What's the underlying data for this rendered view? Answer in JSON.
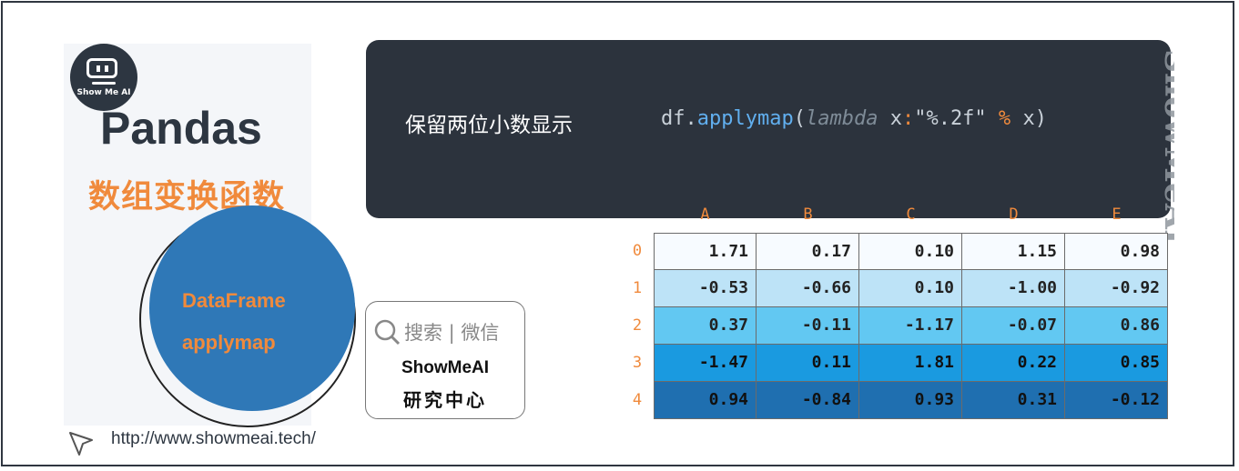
{
  "brand": {
    "logo_text": "Show Me AI",
    "title": "Pandas",
    "subtitle": "数组变换函数",
    "circle_line1": "DataFrame",
    "circle_line2": "applymap",
    "url": "http://www.showmeai.tech/",
    "badge_search": "搜索 | 微信",
    "badge_name": "ShowMeAI",
    "badge_sub": "研究中心",
    "watermark": "ShowMeAI"
  },
  "code": {
    "label": "保留两位小数显示",
    "tokens": {
      "obj": "df",
      "dot": ".",
      "fn": "applymap",
      "paren_open": "(",
      "kw": "lambda",
      "space": " ",
      "arg": "x",
      "colon": ":",
      "fmt": "\"%.2f\"",
      "op": " % ",
      "arg2": "x",
      "paren_close": ")"
    }
  },
  "table": {
    "columns": [
      "A",
      "B",
      "C",
      "D",
      "E"
    ],
    "index": [
      "0",
      "1",
      "2",
      "3",
      "4"
    ],
    "row_colors": [
      "#f7fbff",
      "#bde3f7",
      "#62c8f2",
      "#1a9ae0",
      "#1f6fb0"
    ],
    "rows": [
      [
        "1.71",
        "0.17",
        "0.10",
        "1.15",
        "0.98"
      ],
      [
        "-0.53",
        "-0.66",
        "0.10",
        "-1.00",
        "-0.92"
      ],
      [
        "0.37",
        "-0.11",
        "-1.17",
        "-0.07",
        "0.86"
      ],
      [
        "-1.47",
        "0.11",
        "1.81",
        "0.22",
        "0.85"
      ],
      [
        "0.94",
        "-0.84",
        "0.93",
        "0.31",
        "-0.12"
      ]
    ]
  },
  "icons": [
    "robot-logo-icon",
    "search-icon",
    "cursor-icon"
  ]
}
